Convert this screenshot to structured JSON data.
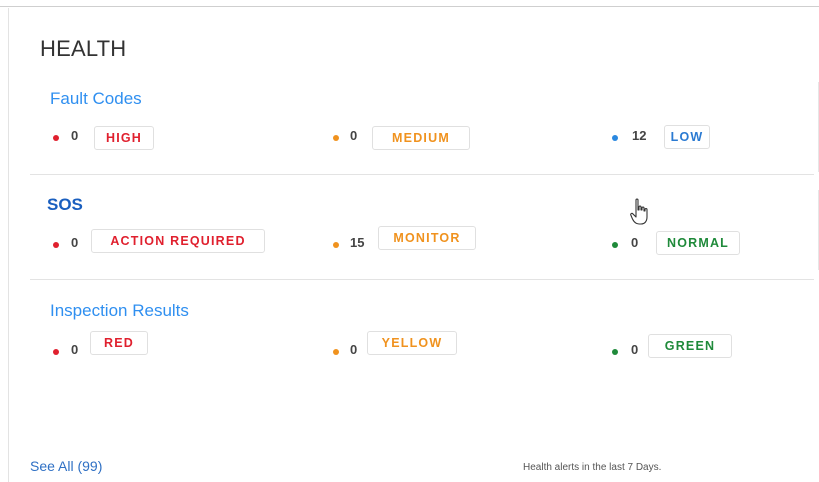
{
  "header": {
    "title": "HEALTH"
  },
  "sections": [
    {
      "title": "Fault Codes",
      "title_color": "#2f8ff0",
      "items": [
        {
          "count": "0",
          "label": "HIGH",
          "color": "#e0202e"
        },
        {
          "count": "0",
          "label": "MEDIUM",
          "color": "#f0921e"
        },
        {
          "count": "12",
          "label": "LOW",
          "color": "#2a7ad2"
        }
      ]
    },
    {
      "title": "SOS",
      "title_color": "#1a5fbf",
      "items": [
        {
          "count": "0",
          "label": "ACTION REQUIRED",
          "color": "#e0202e"
        },
        {
          "count": "15",
          "label": "MONITOR",
          "color": "#f0921e"
        },
        {
          "count": "0",
          "label": "NORMAL",
          "color": "#1f8a3a"
        }
      ]
    },
    {
      "title": "Inspection Results",
      "title_color": "#2f8ff0",
      "items": [
        {
          "count": "0",
          "label": "RED",
          "color": "#e0202e"
        },
        {
          "count": "0",
          "label": "YELLOW",
          "color": "#f0921e"
        },
        {
          "count": "0",
          "label": "GREEN",
          "color": "#1f8a3a"
        }
      ]
    }
  ],
  "footer": {
    "see_all": "See All (99)",
    "note": "Health alerts in the last 7 Days."
  },
  "icons": {
    "cursor": "hand-pointer-icon"
  }
}
